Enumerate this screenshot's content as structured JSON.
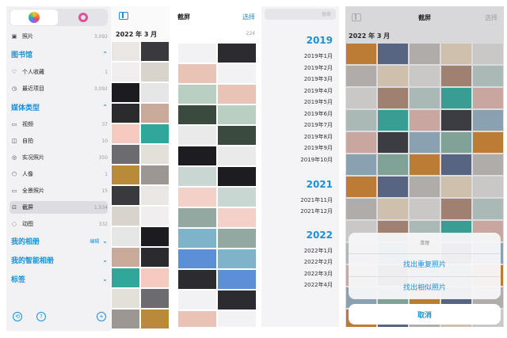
{
  "sidebar": {
    "photos_row": {
      "label": "照片",
      "count": "3,092"
    },
    "library_heading": "图书馆",
    "library_items": [
      {
        "label": "个人收藏",
        "count": "1"
      },
      {
        "label": "最近项目",
        "count": "3,092"
      }
    ],
    "media_heading": "媒体类型",
    "media_items": [
      {
        "label": "视频",
        "count": "37"
      },
      {
        "label": "自拍",
        "count": "10"
      },
      {
        "label": "实况照片",
        "count": "350"
      },
      {
        "label": "人像",
        "count": "1"
      },
      {
        "label": "全景照片",
        "count": "15"
      },
      {
        "label": "截屏",
        "count": "1,534"
      },
      {
        "label": "动图",
        "count": "332"
      }
    ],
    "albums_heading": "我的相册",
    "albums_edit": "编辑",
    "smart_heading": "我的智能相册",
    "tags_heading": "标签",
    "bottom_icons": [
      "clock-icon",
      "help-icon",
      "add-icon"
    ]
  },
  "grid1": {
    "date_header": "2022 年 3 月"
  },
  "panel2": {
    "title": "截屏",
    "select": "选择",
    "count": "224"
  },
  "panel3": {
    "search_placeholder": "搜索",
    "groups": [
      {
        "year": "2019",
        "months": [
          "2019年1月",
          "2019年2月",
          "2019年3月",
          "2019年4月",
          "2019年5月",
          "2019年6月",
          "2019年7月",
          "2019年8月",
          "2019年9月",
          "2019年10月"
        ]
      },
      {
        "year": "2021",
        "months": [
          "2021年11月",
          "2021年12月"
        ]
      },
      {
        "year": "2022",
        "months": [
          "2022年1月",
          "2022年2月",
          "2022年3月",
          "2022年4月"
        ]
      }
    ]
  },
  "panel4": {
    "title": "截屏",
    "select": "选择",
    "date_header": "2022 年 3 月",
    "sheet": {
      "title": "清理",
      "options": [
        "找出重复照片",
        "找出相似照片"
      ],
      "cancel": "取消"
    }
  },
  "colors": {
    "accent": "#1e8fd6",
    "sidebar_bg": "#f2f2f4",
    "selected_row": "#dcdce2"
  }
}
